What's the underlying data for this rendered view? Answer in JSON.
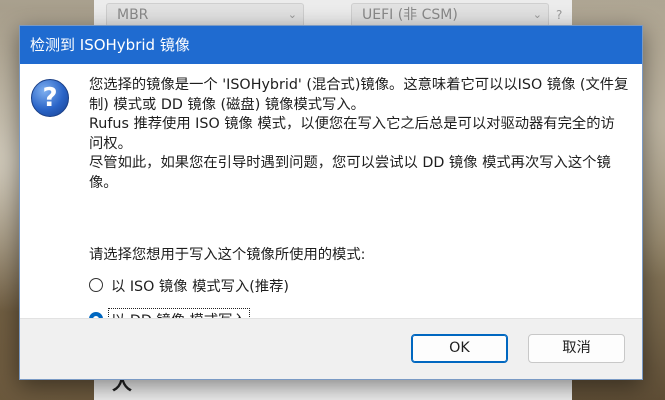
{
  "background_window": {
    "combo_left": "MBR",
    "combo_right": "UEFI (非 CSM)",
    "help_glyph": "?",
    "logo_text": "大"
  },
  "dialog": {
    "title": "检测到 ISOHybrid 镜像",
    "icon": "question-icon",
    "message": [
      "您选择的镜像是一个 'ISOHybrid' (混合式)镜像。这意味着它可以以ISO 镜像 (文件复制) 模式或 DD 镜像 (磁盘) 镜像模式写入。",
      "Rufus 推荐使用 ISO 镜像 模式，以便您在写入它之后总是可以对驱动器有完全的访问权。",
      "尽管如此，如果您在引导时遇到问题，您可以尝试以 DD 镜像 模式再次写入这个镜像。"
    ],
    "prompt": "请选择您想用于写入这个镜像所使用的模式:",
    "options": [
      {
        "label": "以 ISO 镜像 模式写入(推荐)",
        "selected": false
      },
      {
        "label": "以 DD 镜像 模式写入",
        "selected": true
      }
    ],
    "buttons": {
      "ok": "OK",
      "cancel": "取消"
    }
  },
  "colors": {
    "titlebar": "#1f6bd0",
    "accent": "#0067c0",
    "footer": "#f0f0f0"
  }
}
